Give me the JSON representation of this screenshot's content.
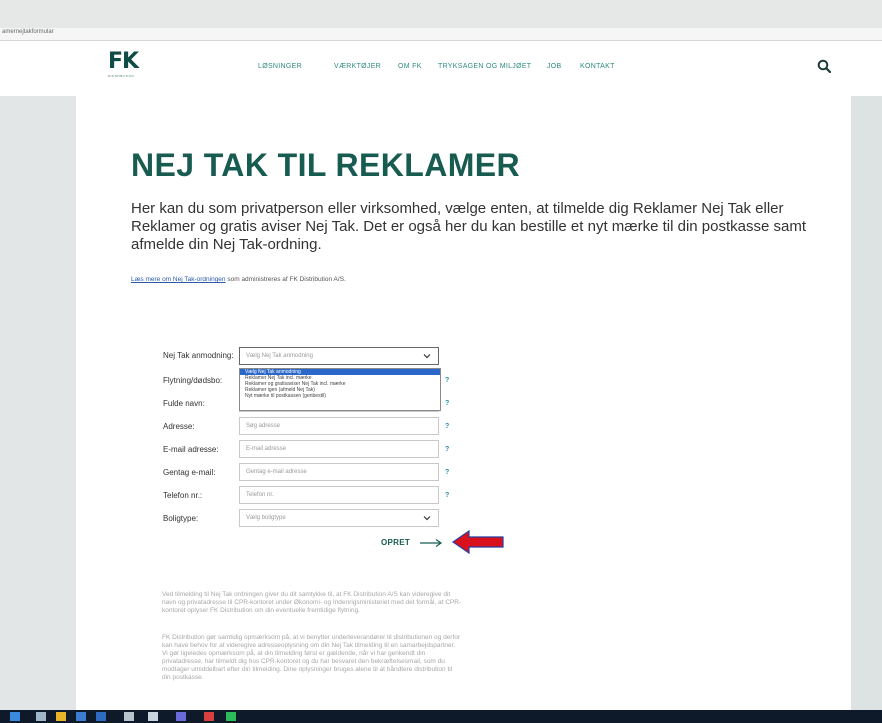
{
  "browser": {
    "url_fragment": "amernejtakformular"
  },
  "header": {
    "logo_text": "FK",
    "logo_subtext": "DISTRIBUTION",
    "nav_items": [
      {
        "label": "LØSNINGER"
      },
      {
        "label": "VÆRKTØJER"
      },
      {
        "label": "OM FK"
      },
      {
        "label": "TRYKSAGEN OG MILJØET"
      },
      {
        "label": "JOB"
      },
      {
        "label": "KONTAKT"
      }
    ]
  },
  "main": {
    "headline": "NEJ TAK TIL REKLAMER",
    "intro": "Her kan du som privatperson eller virksomhed, vælge enten, at tilmelde dig Reklamer Nej Tak eller Reklamer og gratis aviser Nej Tak. Det er også her du kan bestille et nyt mærke til din postkasse samt afmelde din Nej Tak-ordning.",
    "read_more_link": "Læs mere om Nej Tak-ordningen",
    "read_more_rest": " som administreres af FK Distribution A/S."
  },
  "form": {
    "fields": [
      {
        "label": "Nej Tak anmodning:",
        "placeholder": "Vælg Nej Tak anmodning"
      },
      {
        "label": "Flytning/dødsbo:",
        "placeholder": ""
      },
      {
        "label": "Fulde navn:",
        "placeholder": ""
      },
      {
        "label": "Adresse:",
        "placeholder": "Søg adresse"
      },
      {
        "label": "E-mail adresse:",
        "placeholder": "E-mail adresse"
      },
      {
        "label": "Gentag e-mail:",
        "placeholder": "Gentag e-mail adresse"
      },
      {
        "label": "Telefon nr.:",
        "placeholder": "Telefon nr."
      },
      {
        "label": "Boligtype:",
        "placeholder": "Vælg boligtype"
      }
    ],
    "help_mark": "?",
    "dropdown_options": [
      "Vælg Nej Tak anmodning",
      "Reklamer Nej Tak incl. mærke",
      "Reklamer og gratisaviser Nej Tak incl. mærke",
      "Reklamer igen (afmeld Nej Tak)",
      "Nyt mærke til postkassen (genbestil)"
    ],
    "submit_label": "OPRET"
  },
  "fine_print": [
    "Ved tilmelding til Nej Tak ordningen giver du dit samtykke til, at FK Distribution A/S kan videregive dit navn og privatadresse til CPR-kontoret under Økonomi- og Indenrigsministeriet med det formål, at CPR-kontoret oplyser FK Distribution om din eventuelle fremtidige flytning.",
    "FK Distribution gør samtidig opmærksom på, at vi benytter underleverandører til distributionen og derfor kan have behov for at videregive adresseoplysning om din Nej Tak tilmelding til en samarbejdspartner. Vi gør ligeledes opmærksom på, at din tilmelding først er gældende, når vi har genkendt din privatadresse, har tilmeldt dig hos CPR-kontoret og du har besvaret den bekræftelsesmail, som du modtager umiddelbart efter din tilmelding. Dine oplysninger bruges alene til at håndtere distribution til din postkasse."
  ],
  "colors": {
    "brand_green": "#175b51",
    "nav_green": "#2e8a7f",
    "help_blue": "#2e8aa8",
    "highlight_arrow": "#d8111c",
    "dropdown_selected": "#2a67c8"
  },
  "taskbar": {
    "icons": [
      "start-icon",
      "search-icon",
      "file-explorer-icon",
      "mail-icon",
      "calendar-icon",
      "pen-icon",
      "browser-icon",
      "pdf-icon",
      "spotify-icon",
      "app-icon"
    ]
  }
}
